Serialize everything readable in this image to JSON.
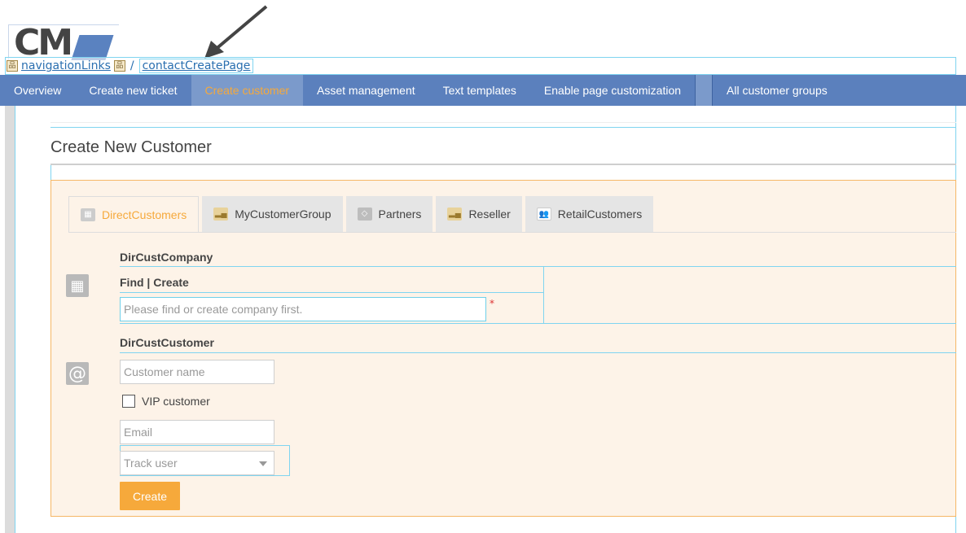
{
  "logo": {
    "text": "CM"
  },
  "breadcrumb": {
    "items": [
      "navigationLinks",
      "contactCreatePage"
    ],
    "separator": "/"
  },
  "nav": {
    "items": [
      {
        "label": "Overview",
        "active": false
      },
      {
        "label": "Create new ticket",
        "active": false
      },
      {
        "label": "Create customer",
        "active": true
      },
      {
        "label": "Asset management",
        "active": false
      },
      {
        "label": "Text templates",
        "active": false
      },
      {
        "label": "Enable page customization",
        "active": false
      }
    ],
    "right_item": "All customer groups"
  },
  "page": {
    "title": "Create New Customer"
  },
  "tabs": [
    {
      "label": "DirectCustomers",
      "icon": "building-icon",
      "active": true
    },
    {
      "label": "MyCustomerGroup",
      "icon": "chart-icon",
      "active": false
    },
    {
      "label": "Partners",
      "icon": "diamond-icon",
      "active": false
    },
    {
      "label": "Reseller",
      "icon": "chart-icon",
      "active": false
    },
    {
      "label": "RetailCustomers",
      "icon": "people-icon",
      "active": false
    }
  ],
  "company_section": {
    "title": "DirCustCompany",
    "subheader": "Find | Create",
    "placeholder": "Please find or create company first.",
    "required_mark": "*"
  },
  "customer_section": {
    "title": "DirCustCustomer",
    "name_placeholder": "Customer name",
    "vip_label": "VIP customer",
    "vip_checked": false,
    "email_placeholder": "Email",
    "track_user_placeholder": "Track user"
  },
  "actions": {
    "create_label": "Create"
  },
  "colors": {
    "nav_bg": "#5b80bd",
    "nav_active_bg": "#7b9acb",
    "accent": "#f6a93b",
    "panel_bg": "#fdf3e8",
    "guide_line": "#7fd4f0"
  }
}
